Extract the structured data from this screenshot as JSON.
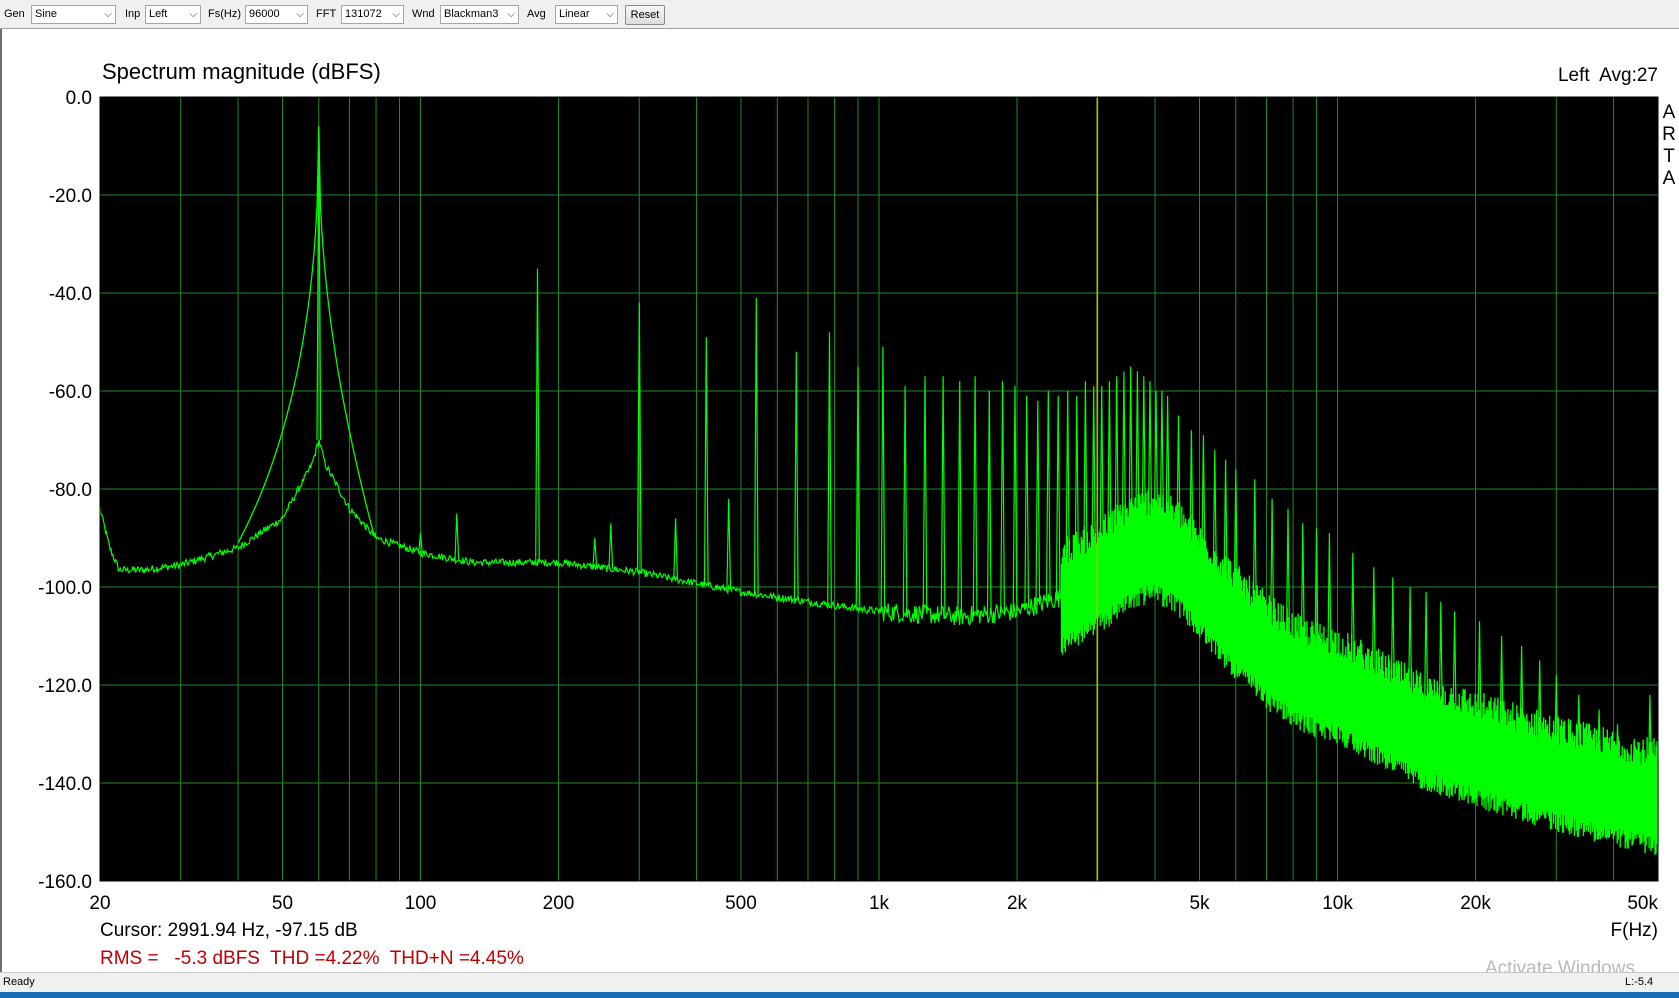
{
  "toolbar": {
    "gen": {
      "label": "Gen",
      "value": "Sine"
    },
    "inp": {
      "label": "Inp",
      "value": "Left"
    },
    "fs": {
      "label": "Fs(Hz)",
      "value": "96000"
    },
    "fft": {
      "label": "FFT",
      "value": "131072"
    },
    "wnd": {
      "label": "Wnd",
      "value": "Blackman3"
    },
    "avg": {
      "label": "Avg",
      "value": "Linear"
    },
    "reset_label": "Reset"
  },
  "panel": {
    "title": "Spectrum magnitude (dBFS)",
    "channel_info": "Left  Avg:27",
    "brand_vertical": "ARTA",
    "cursor_readout": "Cursor: 2991.94 Hz, -97.15 dB",
    "stats_readout": "RMS =   -5.3 dBFS  THD =4.22%  THD+N =4.45%"
  },
  "status": {
    "text": "Ready",
    "level": "L:-5.4"
  },
  "watermark": "Activate Windows",
  "colors": {
    "plot_bg": "#000000",
    "grid": "#1f8a1f",
    "trace": "#00ff00",
    "cursor": "#b8b800",
    "stats_text": "#c00000"
  },
  "chart_data": {
    "type": "line",
    "title": "Spectrum magnitude (dBFS)",
    "xlabel": "F(Hz)",
    "ylabel": "",
    "x_scale": "log",
    "xlim": [
      20,
      50000
    ],
    "ylim": [
      -160,
      0
    ],
    "grid": true,
    "x_ticks": [
      {
        "value": 20,
        "label": "20"
      },
      {
        "value": 50,
        "label": "50"
      },
      {
        "value": 100,
        "label": "100"
      },
      {
        "value": 200,
        "label": "200"
      },
      {
        "value": 500,
        "label": "500"
      },
      {
        "value": 1000,
        "label": "1k"
      },
      {
        "value": 2000,
        "label": "2k"
      },
      {
        "value": 5000,
        "label": "5k"
      },
      {
        "value": 10000,
        "label": "10k"
      },
      {
        "value": 20000,
        "label": "20k"
      },
      {
        "value": 50000,
        "label": "50k"
      }
    ],
    "y_ticks": [
      {
        "value": 0,
        "label": "0.0"
      },
      {
        "value": -20,
        "label": "-20.0"
      },
      {
        "value": -40,
        "label": "-40.0"
      },
      {
        "value": -60,
        "label": "-60.0"
      },
      {
        "value": -80,
        "label": "-80.0"
      },
      {
        "value": -100,
        "label": "-100.0"
      },
      {
        "value": -120,
        "label": "-120.0"
      },
      {
        "value": -140,
        "label": "-140.0"
      },
      {
        "value": -160,
        "label": "-160.0"
      }
    ],
    "cursor": {
      "x": 2991.94,
      "y": -97.15
    },
    "noise_floor": [
      [
        20,
        -84
      ],
      [
        21,
        -92
      ],
      [
        22,
        -96.5
      ],
      [
        25,
        -96.5
      ],
      [
        30,
        -95.5
      ],
      [
        40,
        -92
      ],
      [
        50,
        -86
      ],
      [
        58,
        -75
      ],
      [
        60,
        -70
      ],
      [
        62,
        -75
      ],
      [
        70,
        -84
      ],
      [
        80,
        -90
      ],
      [
        100,
        -93
      ],
      [
        130,
        -95
      ],
      [
        170,
        -95
      ],
      [
        200,
        -95
      ],
      [
        300,
        -97
      ],
      [
        500,
        -101
      ],
      [
        700,
        -103
      ],
      [
        1000,
        -105
      ],
      [
        1500,
        -106
      ],
      [
        2000,
        -105
      ],
      [
        2500,
        -102
      ],
      [
        3000,
        -98
      ],
      [
        3500,
        -93
      ],
      [
        4000,
        -91
      ],
      [
        4500,
        -94
      ],
      [
        5000,
        -99
      ],
      [
        6000,
        -107
      ],
      [
        7000,
        -113
      ],
      [
        8000,
        -117
      ],
      [
        9000,
        -119
      ],
      [
        10000,
        -120
      ],
      [
        12000,
        -124
      ],
      [
        15000,
        -129
      ],
      [
        20000,
        -133
      ],
      [
        30000,
        -138
      ],
      [
        40000,
        -141
      ],
      [
        50000,
        -143
      ]
    ],
    "peaks": [
      {
        "x": 60,
        "y": -6
      },
      {
        "x": 100,
        "y": -89
      },
      {
        "x": 120,
        "y": -85
      },
      {
        "x": 180,
        "y": -35
      },
      {
        "x": 240,
        "y": -90
      },
      {
        "x": 260,
        "y": -87
      },
      {
        "x": 300,
        "y": -42
      },
      {
        "x": 360,
        "y": -86
      },
      {
        "x": 420,
        "y": -49
      },
      {
        "x": 470,
        "y": -82
      },
      {
        "x": 540,
        "y": -41
      },
      {
        "x": 660,
        "y": -52
      },
      {
        "x": 780,
        "y": -48
      },
      {
        "x": 900,
        "y": -55
      },
      {
        "x": 1020,
        "y": -51
      },
      {
        "x": 1140,
        "y": -59
      },
      {
        "x": 1260,
        "y": -57
      },
      {
        "x": 1380,
        "y": -57
      },
      {
        "x": 1500,
        "y": -58
      },
      {
        "x": 1620,
        "y": -57
      },
      {
        "x": 1740,
        "y": -60
      },
      {
        "x": 1860,
        "y": -58
      },
      {
        "x": 1980,
        "y": -59
      },
      {
        "x": 2100,
        "y": -61
      },
      {
        "x": 2220,
        "y": -62
      },
      {
        "x": 2340,
        "y": -60
      },
      {
        "x": 2460,
        "y": -61
      },
      {
        "x": 2580,
        "y": -60
      },
      {
        "x": 2700,
        "y": -61
      },
      {
        "x": 2820,
        "y": -58
      },
      {
        "x": 2940,
        "y": -59
      },
      {
        "x": 3060,
        "y": -59
      },
      {
        "x": 3180,
        "y": -58
      },
      {
        "x": 3300,
        "y": -57
      },
      {
        "x": 3420,
        "y": -56
      },
      {
        "x": 3540,
        "y": -55
      },
      {
        "x": 3660,
        "y": -56
      },
      {
        "x": 3780,
        "y": -57
      },
      {
        "x": 3900,
        "y": -58
      },
      {
        "x": 4020,
        "y": -60
      },
      {
        "x": 4140,
        "y": -60
      },
      {
        "x": 4260,
        "y": -61
      },
      {
        "x": 4500,
        "y": -65
      },
      {
        "x": 4800,
        "y": -68
      },
      {
        "x": 5100,
        "y": -69
      },
      {
        "x": 5400,
        "y": -72
      },
      {
        "x": 5700,
        "y": -74
      },
      {
        "x": 6000,
        "y": -76
      },
      {
        "x": 6600,
        "y": -78
      },
      {
        "x": 7200,
        "y": -82
      },
      {
        "x": 7800,
        "y": -84
      },
      {
        "x": 8400,
        "y": -87
      },
      {
        "x": 9000,
        "y": -88
      },
      {
        "x": 9600,
        "y": -89
      },
      {
        "x": 10800,
        "y": -93
      },
      {
        "x": 12000,
        "y": -96
      },
      {
        "x": 13200,
        "y": -98
      },
      {
        "x": 14400,
        "y": -100
      },
      {
        "x": 15600,
        "y": -101
      },
      {
        "x": 16800,
        "y": -103
      },
      {
        "x": 18000,
        "y": -105
      },
      {
        "x": 20400,
        "y": -107
      },
      {
        "x": 22800,
        "y": -110
      },
      {
        "x": 25200,
        "y": -112
      },
      {
        "x": 27600,
        "y": -115
      },
      {
        "x": 30000,
        "y": -118
      },
      {
        "x": 33600,
        "y": -122
      },
      {
        "x": 37200,
        "y": -125
      },
      {
        "x": 40800,
        "y": -128
      },
      {
        "x": 44400,
        "y": -131
      },
      {
        "x": 48000,
        "y": -122
      }
    ]
  }
}
